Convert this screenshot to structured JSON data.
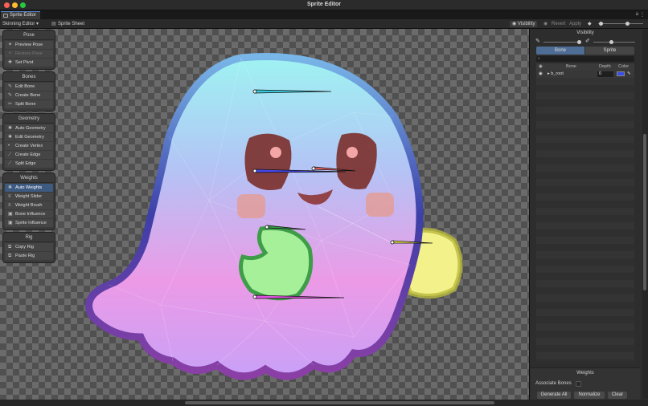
{
  "window": {
    "title": "Sprite Editor"
  },
  "tab": {
    "label": "Sprite Editor",
    "menu": "⋮"
  },
  "toolbar": {
    "mode": "Skinning Editor ▾",
    "sprite_sheet": "Sprite Sheet",
    "visibility": "Visibility",
    "revert": "Revert",
    "apply": "Apply"
  },
  "tools": {
    "pose": {
      "title": "Pose",
      "items": [
        "Preview Pose",
        "Restore Pose",
        "Set Pivot"
      ]
    },
    "bones": {
      "title": "Bones",
      "items": [
        "Edit Bone",
        "Create Bone",
        "Split Bone"
      ]
    },
    "geometry": {
      "title": "Geometry",
      "items": [
        "Auto Geometry",
        "Edit Geometry",
        "Create Vertex",
        "Create Edge",
        "Split Edge"
      ]
    },
    "weights": {
      "title": "Weights",
      "items": [
        "Auto Weights",
        "Weight Slider",
        "Weight Brush",
        "Bone Influence",
        "Sprite Influence"
      ]
    },
    "rig": {
      "title": "Rig",
      "items": [
        "Copy Rig",
        "Paste Rig"
      ]
    }
  },
  "visibility_panel": {
    "title": "Visibility",
    "tab_bone": "Bone",
    "tab_sprite": "Sprite",
    "columns": {
      "bone": "Bone",
      "depth": "Depth",
      "color": "Color"
    },
    "rows": [
      {
        "name": "▸ b_root",
        "depth": "0",
        "color": "#3a4ee8"
      }
    ]
  },
  "weights_panel": {
    "title": "Weights",
    "associate_label": "Associate Bones",
    "generate": "Generate All",
    "normalize": "Normalize",
    "clear": "Clear"
  },
  "colors": {
    "accent": "#3d5a80",
    "selected_tab": "#4e6d94"
  },
  "icons": [
    "preview-pose-icon",
    "eye-icon",
    "bone-icon",
    "sprite-icon",
    "search-icon",
    "color-picker-icon"
  ]
}
